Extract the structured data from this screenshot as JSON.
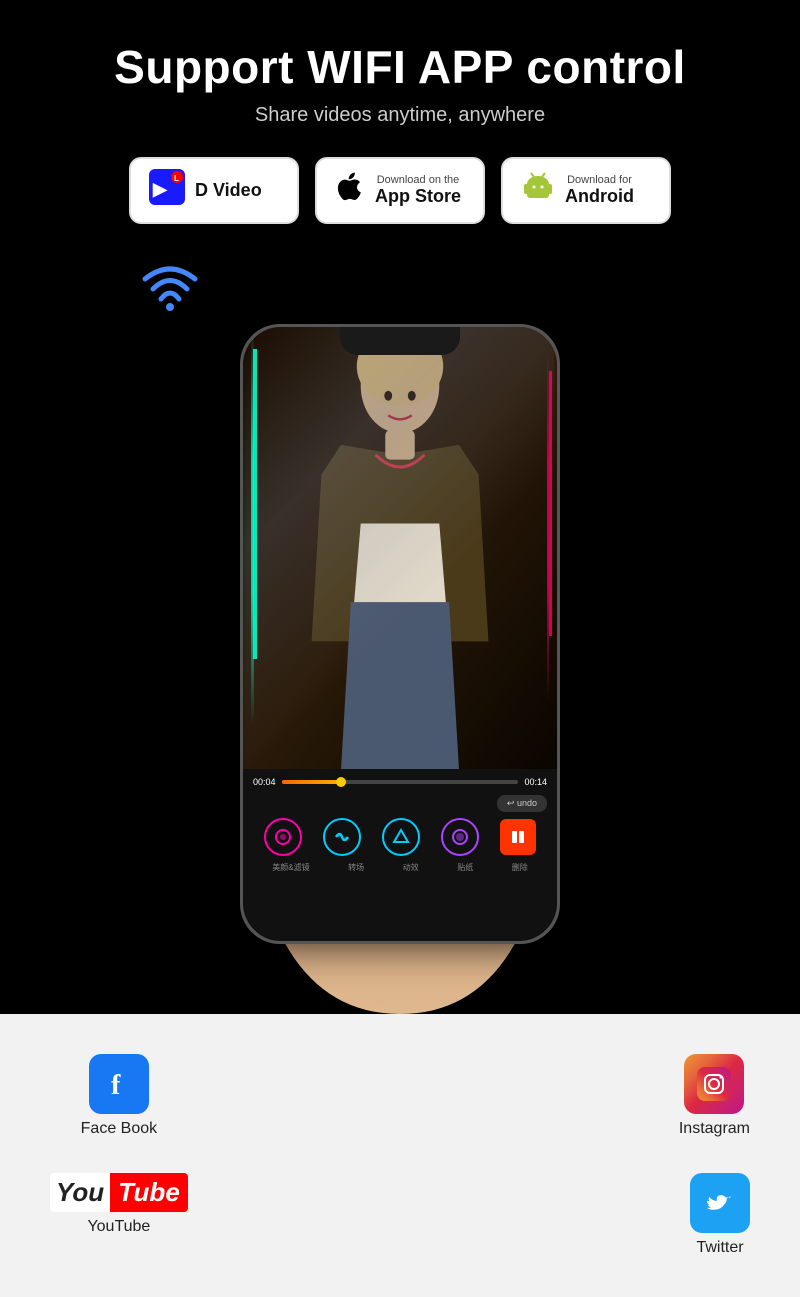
{
  "page": {
    "bg_color": "#000000",
    "title": "Support WIFI APP control",
    "subtitle": "Share videos anytime, anywhere"
  },
  "buttons": {
    "dvideo": {
      "label": "D Video",
      "icon": "📹"
    },
    "appstore": {
      "line1": "Download on the",
      "line2": "App Store",
      "icon": "🍎"
    },
    "android": {
      "line1": "Download for",
      "line2": "Android",
      "icon": "🤖"
    }
  },
  "video": {
    "time_start": "00:04",
    "time_end": "00:14",
    "progress_percent": 25
  },
  "socials": {
    "facebook": {
      "label": "Face Book",
      "color": "#1877f2"
    },
    "youtube": {
      "label": "YouTube",
      "you_color": "#fff",
      "tube_color": "#ff0000"
    },
    "instagram": {
      "label": "Instagram"
    },
    "twitter": {
      "label": "Twitter",
      "color": "#1da1f2"
    }
  }
}
